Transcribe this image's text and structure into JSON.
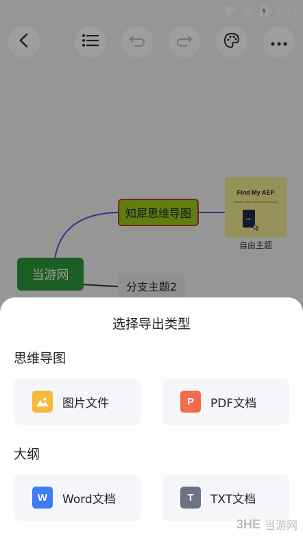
{
  "status_bar": {
    "time": "4:43"
  },
  "toolbar": {
    "buttons": [
      {
        "name": "back-button",
        "icon": "chevron-left-icon"
      },
      {
        "name": "outline-button",
        "icon": "list-icon"
      },
      {
        "name": "undo-button",
        "icon": "undo-icon"
      },
      {
        "name": "redo-button",
        "icon": "redo-icon"
      },
      {
        "name": "theme-button",
        "icon": "palette-icon"
      },
      {
        "name": "more-button",
        "icon": "more-icon"
      }
    ]
  },
  "mindmap": {
    "root": "当游网",
    "branch1": "知犀思维导图",
    "branch2": "分支主题2",
    "floating_topic": "自由主题",
    "image_title": "Find My AEP",
    "image_subtitle": "Rental Coffee Project Plan & Finder",
    "image_badge": "AEP",
    "colors": {
      "root_bg": "#2e9a3a",
      "branch_bg": "#9acb1e",
      "branch_border": "#c0392b",
      "line": "#5b4fcf",
      "image_bg": "#f3ea8f"
    }
  },
  "sheet": {
    "title": "选择导出类型",
    "sections": [
      {
        "label": "思维导图",
        "items": [
          {
            "label": "图片文件",
            "icon": "image-file-icon",
            "color": "#f6b93b",
            "glyph": ""
          },
          {
            "label": "PDF文档",
            "icon": "pdf-file-icon",
            "color": "#f26b4a",
            "glyph": "P"
          }
        ]
      },
      {
        "label": "大纲",
        "items": [
          {
            "label": "Word文档",
            "icon": "word-file-icon",
            "color": "#3d7cf5",
            "glyph": "W"
          },
          {
            "label": "TXT文档",
            "icon": "txt-file-icon",
            "color": "#6b7485",
            "glyph": "T"
          }
        ]
      }
    ]
  },
  "watermark": {
    "logo": "3HE",
    "text": "当游网"
  }
}
